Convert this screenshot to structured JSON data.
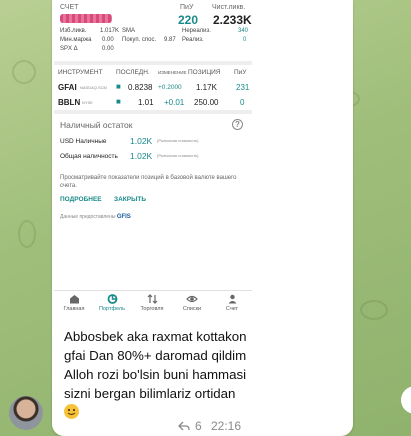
{
  "account": {
    "label": "СЧЕТ",
    "pnl_label": "ПиУ",
    "pnl_value": "220",
    "liq_label": "Чист.ликв.",
    "liq_value": "2.233K"
  },
  "metrics": [
    {
      "l1": "Изб.ликв.",
      "v1": "1.017K",
      "l2": "SMA",
      "v2": "",
      "l3": "Нереализ.",
      "v3": "340"
    },
    {
      "l1": "Мин.маржа",
      "v1": "0.00",
      "l2": "Покуп. спос.",
      "v2": "9.87",
      "l3": "Реализ.",
      "v3": "0"
    },
    {
      "l1": "SPX Δ",
      "v1": "0.00",
      "l2": "",
      "v2": "",
      "l3": "",
      "v3": ""
    }
  ],
  "table": {
    "headers": {
      "instrument": "ИНСТРУМЕНТ",
      "last": "ПОСЛЕДН.",
      "change": "ИЗМЕНЕНИЕ",
      "position": "ПОЗИЦИЯ",
      "pnl": "ПиУ"
    },
    "rows": [
      {
        "symbol": "GFAI",
        "exchange": "NASDAQ.SCM",
        "last": "0.8238",
        "change": "+0.2000",
        "position": "1.17K",
        "pnl": "231"
      },
      {
        "symbol": "BBLN",
        "exchange": "NYSE",
        "last": "1.01",
        "change": "+0.01",
        "position": "250.00",
        "pnl": "0"
      }
    ]
  },
  "cash": {
    "title": "Наличный остаток",
    "rows": [
      {
        "label": "USD Наличные",
        "value": "1.02K",
        "note": "(Рыночная стоимость)"
      },
      {
        "label": "Общая наличность",
        "value": "1.02K",
        "note": "(Рыночная стоимость)"
      }
    ],
    "note": "Просматривайте показатели позиций в базовой валюте вашего счета.",
    "more_link": "ПОДРОБНЕЕ",
    "close_link": "ЗАКРЫТЬ",
    "provider_label": "Данные предоставлены",
    "provider_name": "GFIS"
  },
  "tabs": [
    {
      "label": "Главная",
      "icon": "home-icon"
    },
    {
      "label": "Портфель",
      "icon": "portfolio-icon",
      "active": true
    },
    {
      "label": "Торговля",
      "icon": "trade-icon"
    },
    {
      "label": "Списки",
      "icon": "eye-icon"
    },
    {
      "label": "Счет",
      "icon": "account-icon"
    }
  ],
  "message": {
    "text": "Abbosbek aka raxmat kottakon gfai Dan 80%+ daromad qildim Alloh rozi bo'lsin buni hammasi sizni bergan  bilimlariz ortidan",
    "emoji": "smiling-face-emoji",
    "views": "6",
    "time": "22:16"
  },
  "colors": {
    "accent": "#1a8a8a",
    "chat_bg": "#a8c584",
    "bubble": "#ffffff"
  }
}
